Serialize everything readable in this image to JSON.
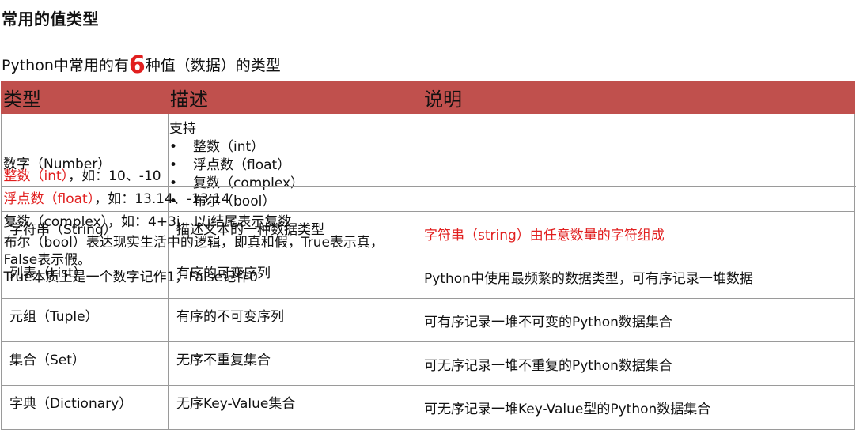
{
  "title": "常用的值类型",
  "intro": {
    "before": "Python中常用的有",
    "number": "6",
    "after": "种值（数据）的类型"
  },
  "table": {
    "headers": [
      "类型",
      "描述",
      "说明"
    ],
    "number_row": {
      "type": "数字（Number）",
      "support_label": "支持",
      "bullets": [
        "整数（int）",
        "浮点数（float）",
        "复数（complex）",
        "布尔（bool）"
      ],
      "notes": [
        {
          "red": "整数（int）",
          "rest": "，如：10、-10"
        },
        {
          "red": "浮点数（float）",
          "rest": "，如：13.14、-13.14"
        },
        {
          "red": "",
          "rest": "复数（complex），如：4+3j，以j结尾表示复数"
        },
        {
          "red": "",
          "rest": "布尔（bool）表达现实生活中的逻辑，即真和假，True表示真，\nFalse表示假。\nTrue本质上是一个数字记作1，False记作0"
        }
      ]
    },
    "rows": [
      {
        "type": "字符串（String）",
        "desc": "描述文本的一种数据类型",
        "note": "字符串（string）由任意数量的字符组成",
        "note_red": true
      },
      {
        "type": "列表（List）",
        "desc": "有序的可变序列",
        "note": "Python中使用最频繁的数据类型，可有序记录一堆数据",
        "note_red": false
      },
      {
        "type": "元组（Tuple）",
        "desc": "有序的不可变序列",
        "note": "可有序记录一堆不可变的Python数据集合",
        "note_red": false
      },
      {
        "type": "集合（Set）",
        "desc": "无序不重复集合",
        "note": "可无序记录一堆不重复的Python数据集合",
        "note_red": false
      },
      {
        "type": "字典（Dictionary）",
        "desc": "无序Key-Value集合",
        "note": "可无序记录一堆Key-Value型的Python数据集合",
        "note_red": false
      }
    ]
  },
  "colors": {
    "header_bg": "#c0504d",
    "highlight": "#e11f1f",
    "border": "#9a9a9a"
  }
}
